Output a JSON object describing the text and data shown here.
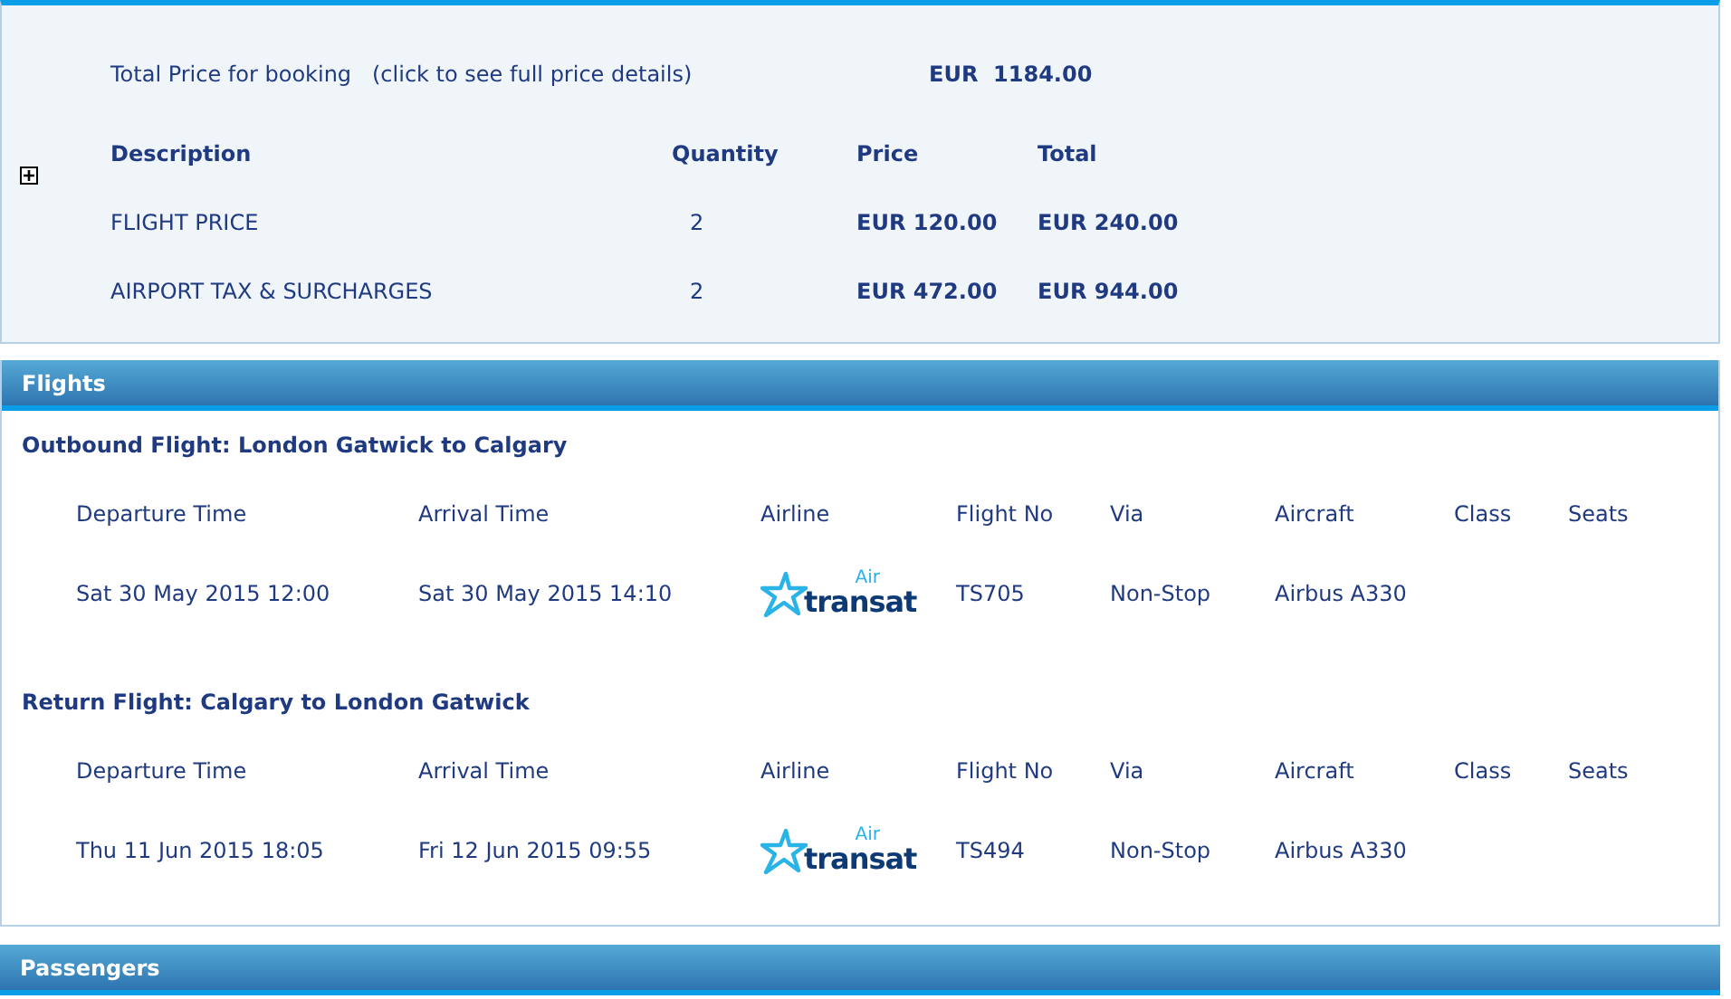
{
  "price_summary": {
    "label": "Total Price for booking",
    "link": "(click to see full price details)",
    "total": "EUR  1184.00",
    "expanded": false,
    "columns": [
      "Description",
      "Quantity",
      "Price",
      "Total"
    ],
    "rows": [
      {
        "description": "FLIGHT PRICE",
        "quantity": "2",
        "price": "EUR 120.00",
        "total": "EUR 240.00"
      },
      {
        "description": "AIRPORT TAX & SURCHARGES",
        "quantity": "2",
        "price": "EUR 472.00",
        "total": "EUR 944.00"
      }
    ]
  },
  "flights": {
    "title": "Flights",
    "legs": [
      {
        "heading": "Outbound Flight: London Gatwick to Calgary",
        "columns": [
          "Departure Time",
          "Arrival Time",
          "Airline",
          "Flight No",
          "Via",
          "Aircraft",
          "Class",
          "Seats"
        ],
        "departure": "Sat 30 May 2015 12:00",
        "arrival": "Sat 30 May 2015 14:10",
        "airline_logo": {
          "small": "Air",
          "large": "transat"
        },
        "flight_no": "TS705",
        "via": "Non-Stop",
        "aircraft": "Airbus A330"
      },
      {
        "heading": "Return Flight: Calgary to London Gatwick",
        "columns": [
          "Departure Time",
          "Arrival Time",
          "Airline",
          "Flight No",
          "Via",
          "Aircraft",
          "Class",
          "Seats"
        ],
        "departure": "Thu 11 Jun 2015 18:05",
        "arrival": "Fri 12 Jun 2015 09:55",
        "airline_logo": {
          "small": "Air",
          "large": "transat"
        },
        "flight_no": "TS494",
        "via": "Non-Stop",
        "aircraft": "Airbus A330"
      }
    ]
  },
  "passengers": {
    "title": "Passengers"
  }
}
